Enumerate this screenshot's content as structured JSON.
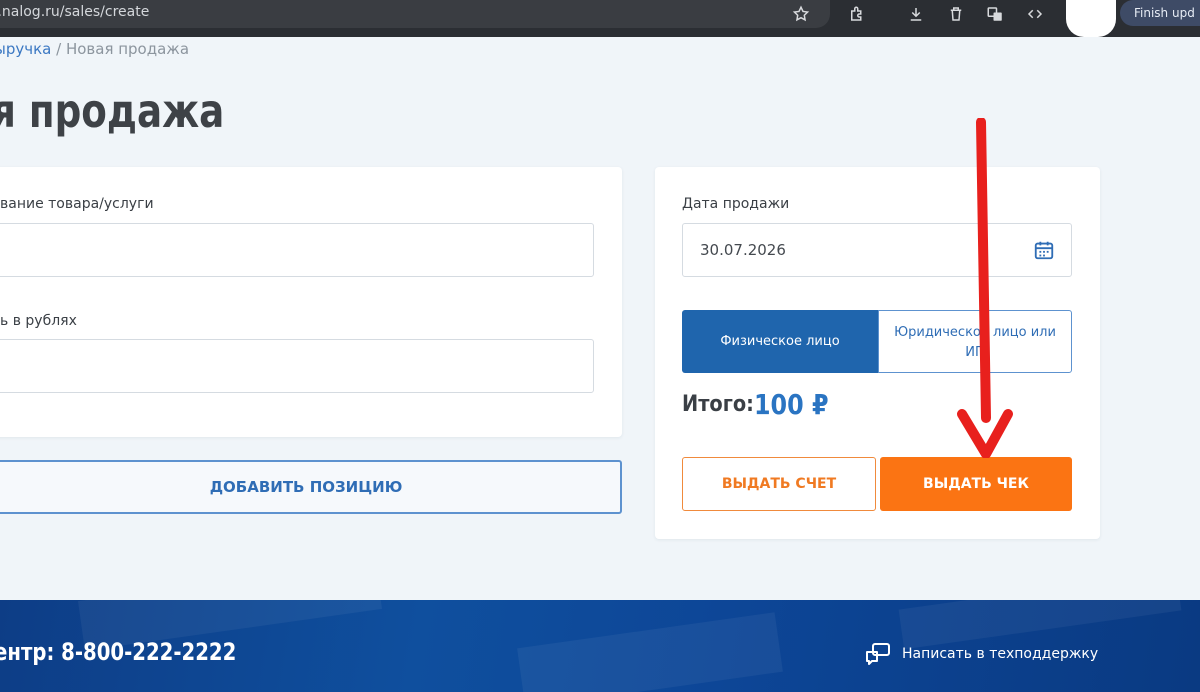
{
  "browser": {
    "url": "od.nalog.ru/sales/create",
    "finish_label": "Finish upd"
  },
  "breadcrumb": {
    "parent": "ыручка",
    "separator": " / ",
    "current": "Новая продажа"
  },
  "page_title": "я продажа",
  "form": {
    "name_label": "вание товара/услуги",
    "name_value": "",
    "price_label": "ь в рублях",
    "price_value": "",
    "add_position_label": "ДОБАВИТЬ ПОЗИЦИЮ"
  },
  "sale": {
    "date_label": "Дата продажи",
    "date_value": "30.07.2026",
    "client_type": {
      "individual": "Физическое лицо",
      "legal": "Юридическое лицо или ИП",
      "selected": "individual"
    },
    "total_label": "Итого:",
    "total_value": "100 ₽",
    "issue_invoice_label": "ВЫДАТЬ СЧЕТ",
    "issue_receipt_label": "ВЫДАТЬ ЧЕК"
  },
  "footer": {
    "phone_text": "ентр: 8-800-222-2222",
    "support_label": "Написать в техподдержку"
  },
  "colors": {
    "primary_blue": "#1f65ad",
    "accent_orange": "#fb7413",
    "annotation_red": "#e8201d",
    "footer_blue": "#0f4f9e"
  },
  "icons": {
    "calendar": "calendar-icon",
    "support": "chat-bubbles-icon",
    "annotation": "red-arrow-down"
  }
}
